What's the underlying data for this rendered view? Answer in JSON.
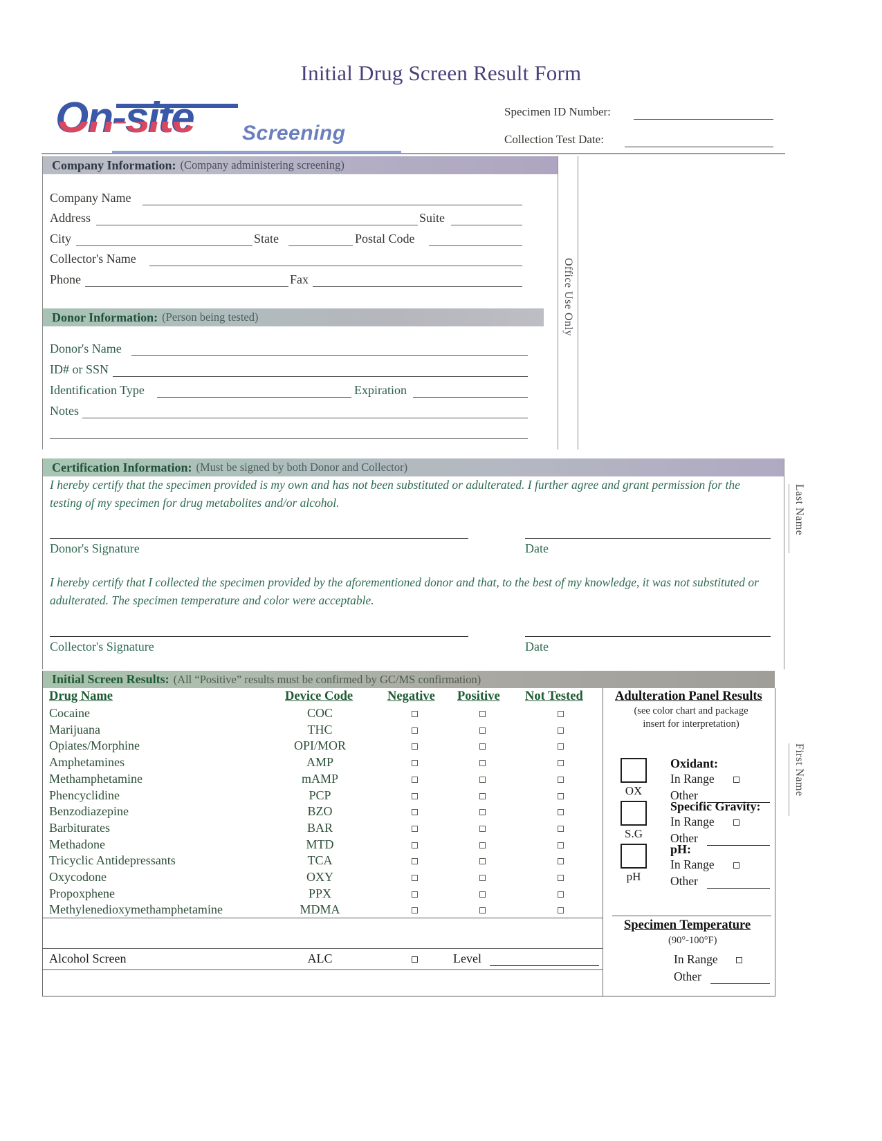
{
  "document": {
    "title": "Initial Drug Screen Result Form"
  },
  "logo": {
    "main": "On-site",
    "sub": "Screening",
    "brand_blue": "#3a57a8",
    "brand_red": "#d9485f",
    "sub_blue": "#6b7fbe"
  },
  "specimen_header": {
    "id_label": "Specimen ID Number:",
    "date_label": "Collection Test Date:"
  },
  "company_section": {
    "heading": "Company Information:",
    "note": "(Company administering screening)",
    "fields": {
      "company_name": "Company Name",
      "address": "Address",
      "suite": "Suite",
      "city": "City",
      "state": "State",
      "postal_code": "Postal Code",
      "collector_name": "Collector's Name",
      "phone": "Phone",
      "fax": "Fax"
    }
  },
  "donor_section": {
    "heading": "Donor Information:",
    "note": "(Person being tested)",
    "fields": {
      "donor_name": "Donor's Name",
      "id_ssn": "ID# or SSN",
      "id_type": "Identification Type",
      "expiration": "Expiration",
      "notes": "Notes"
    }
  },
  "office_use": {
    "label": "Office Use Only"
  },
  "side_labels": {
    "last_name": "Last Name",
    "first_name": "First Name"
  },
  "certification_section": {
    "heading": "Certification Information:",
    "note": "(Must be signed by both Donor and Collector)",
    "donor_statement": "I hereby certify that the specimen provided is my own and has not been substituted or adulterated. I further agree and grant permission for the testing of my specimen for drug metabolites and/or alcohol.",
    "collector_statement": "I hereby certify that I collected the specimen provided by the aforementioned donor and that, to the best of my knowledge, it was not substituted or adulterated. The specimen temperature and color were acceptable.",
    "donor_signature_label": "Donor's Signature",
    "donor_date_label": "Date",
    "collector_signature_label": "Collector's Signature",
    "collector_date_label": "Date"
  },
  "results_section": {
    "heading": "Initial Screen Results:",
    "note": "(All “Positive” results must be confirmed by GC/MS confirmation)",
    "columns": [
      "Drug Name",
      "Device Code",
      "Negative",
      "Positive",
      "Not Tested"
    ],
    "rows": [
      {
        "drug": "Cocaine",
        "code": "COC",
        "negative": false,
        "positive": false,
        "not_tested": false
      },
      {
        "drug": "Marijuana",
        "code": "THC",
        "negative": false,
        "positive": false,
        "not_tested": false
      },
      {
        "drug": "Opiates/Morphine",
        "code": "OPI/MOR",
        "negative": false,
        "positive": false,
        "not_tested": false
      },
      {
        "drug": "Amphetamines",
        "code": "AMP",
        "negative": false,
        "positive": false,
        "not_tested": false
      },
      {
        "drug": "Methamphetamine",
        "code": "mAMP",
        "negative": false,
        "positive": false,
        "not_tested": false
      },
      {
        "drug": "Phencyclidine",
        "code": "PCP",
        "negative": false,
        "positive": false,
        "not_tested": false
      },
      {
        "drug": "Benzodiazepine",
        "code": "BZO",
        "negative": false,
        "positive": false,
        "not_tested": false
      },
      {
        "drug": "Barbiturates",
        "code": "BAR",
        "negative": false,
        "positive": false,
        "not_tested": false
      },
      {
        "drug": "Methadone",
        "code": "MTD",
        "negative": false,
        "positive": false,
        "not_tested": false
      },
      {
        "drug": "Tricyclic Antidepressants",
        "code": "TCA",
        "negative": false,
        "positive": false,
        "not_tested": false
      },
      {
        "drug": "Oxycodone",
        "code": "OXY",
        "negative": false,
        "positive": false,
        "not_tested": false
      },
      {
        "drug": "Propoxphene",
        "code": "PPX",
        "negative": false,
        "positive": false,
        "not_tested": false
      },
      {
        "drug": "Methylenedioxymethamphetamine",
        "code": "MDMA",
        "negative": false,
        "positive": false,
        "not_tested": false
      }
    ],
    "alcohol_row": {
      "drug": "Alcohol Screen",
      "code": "ALC",
      "level_label": "Level"
    }
  },
  "adulteration_panel": {
    "title": "Adulteration Panel Results",
    "subtitle_line1": "(see color chart and package",
    "subtitle_line2": "insert for interpretation)",
    "items": [
      {
        "code": "OX",
        "name": "Oxidant:",
        "in_range_label": "In Range",
        "other_label": "Other"
      },
      {
        "code": "S.G",
        "name": "Specific Gravity:",
        "in_range_label": "In Range",
        "other_label": "Other"
      },
      {
        "code": "pH",
        "name": "pH:",
        "in_range_label": "In Range",
        "other_label": "Other"
      }
    ]
  },
  "specimen_temperature": {
    "title": "Specimen Temperature",
    "range": "(90°-100°F)",
    "in_range_label": "In Range",
    "other_label": "Other"
  }
}
